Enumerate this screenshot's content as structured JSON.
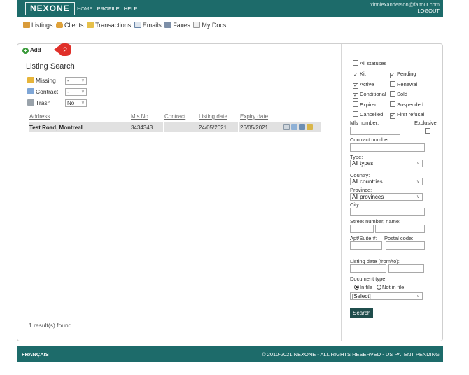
{
  "header": {
    "logo": "NEXONE",
    "nav": [
      "HOME",
      "PROFILE",
      "HELP"
    ],
    "user_email": "xinniexanderson@faitour.com",
    "logout": "LOGOUT"
  },
  "mainnav": [
    "Listings",
    "Clients",
    "Transactions",
    "Emails",
    "Faxes",
    "My Docs"
  ],
  "add_label": "Add",
  "badge": "2",
  "listing_search": {
    "title": "Listing Search",
    "missing_label": "Missing",
    "missing_value": "-",
    "contract_label": "Contract",
    "contract_value": "-",
    "trash_label": "Trash",
    "trash_value": "No"
  },
  "table": {
    "columns": [
      "Address",
      "Mls No",
      "Contract",
      "Listing date",
      "Expiry date"
    ],
    "rows": [
      {
        "address": "Test Road, Montreal",
        "mls": "3434343",
        "contract": "",
        "listing_date": "24/05/2021",
        "expiry_date": "26/05/2021"
      }
    ]
  },
  "results": "1 result(s) found",
  "filters": {
    "all_statuses": "All statuses",
    "statuses": [
      {
        "label": "Kit",
        "checked": true
      },
      {
        "label": "Pending",
        "checked": true
      },
      {
        "label": "Active",
        "checked": true
      },
      {
        "label": "Renewal",
        "checked": false
      },
      {
        "label": "Conditional",
        "checked": true
      },
      {
        "label": "Sold",
        "checked": false
      },
      {
        "label": "Expired",
        "checked": false
      },
      {
        "label": "Suspended",
        "checked": false
      },
      {
        "label": "Cancelled",
        "checked": false
      },
      {
        "label": "First refusal",
        "checked": true
      }
    ],
    "mls_number": "Mls number:",
    "exclusive": "Exclusive:",
    "contract_number": "Contract number:",
    "type_label": "Type:",
    "type_value": "All types",
    "country_label": "Country:",
    "country_value": "All countries",
    "province_label": "Province:",
    "province_value": "All provinces",
    "city_label": "City:",
    "street_label": "Street number, name:",
    "apt_label": "Apt/Suite #:",
    "postal_label": "Postal code:",
    "listing_date_label": "Listing date (from/to):",
    "document_type_label": "Document type:",
    "in_file": "In file",
    "not_in_file": "Not in file",
    "document_value": "[Select]",
    "search_button": "Search"
  },
  "footer": {
    "language": "FRANÇAIS",
    "copyright": "© 2010-2021 NEXONE - ALL RIGHTS RESERVED - US PATENT PENDING"
  },
  "colors": {
    "header_bg": "#1d6b6a",
    "badge_red": "#e0302a",
    "search_btn": "#1f4d4c"
  }
}
